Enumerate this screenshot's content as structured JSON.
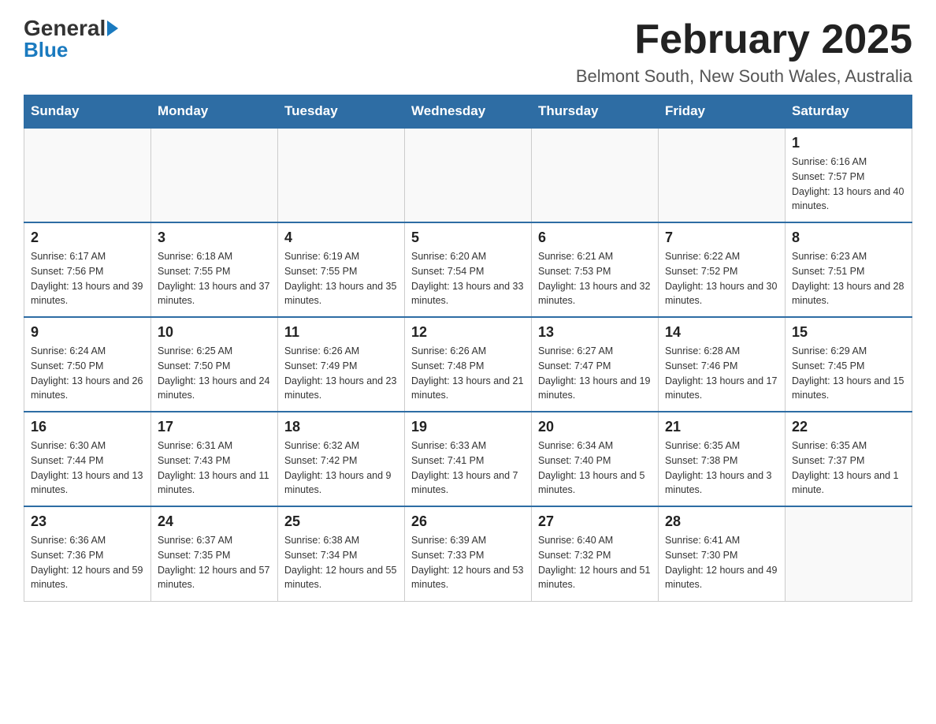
{
  "logo": {
    "general": "General",
    "blue": "Blue"
  },
  "title": "February 2025",
  "subtitle": "Belmont South, New South Wales, Australia",
  "weekdays": [
    "Sunday",
    "Monday",
    "Tuesday",
    "Wednesday",
    "Thursday",
    "Friday",
    "Saturday"
  ],
  "weeks": [
    [
      {
        "day": "",
        "sunrise": "",
        "sunset": "",
        "daylight": ""
      },
      {
        "day": "",
        "sunrise": "",
        "sunset": "",
        "daylight": ""
      },
      {
        "day": "",
        "sunrise": "",
        "sunset": "",
        "daylight": ""
      },
      {
        "day": "",
        "sunrise": "",
        "sunset": "",
        "daylight": ""
      },
      {
        "day": "",
        "sunrise": "",
        "sunset": "",
        "daylight": ""
      },
      {
        "day": "",
        "sunrise": "",
        "sunset": "",
        "daylight": ""
      },
      {
        "day": "1",
        "sunrise": "Sunrise: 6:16 AM",
        "sunset": "Sunset: 7:57 PM",
        "daylight": "Daylight: 13 hours and 40 minutes."
      }
    ],
    [
      {
        "day": "2",
        "sunrise": "Sunrise: 6:17 AM",
        "sunset": "Sunset: 7:56 PM",
        "daylight": "Daylight: 13 hours and 39 minutes."
      },
      {
        "day": "3",
        "sunrise": "Sunrise: 6:18 AM",
        "sunset": "Sunset: 7:55 PM",
        "daylight": "Daylight: 13 hours and 37 minutes."
      },
      {
        "day": "4",
        "sunrise": "Sunrise: 6:19 AM",
        "sunset": "Sunset: 7:55 PM",
        "daylight": "Daylight: 13 hours and 35 minutes."
      },
      {
        "day": "5",
        "sunrise": "Sunrise: 6:20 AM",
        "sunset": "Sunset: 7:54 PM",
        "daylight": "Daylight: 13 hours and 33 minutes."
      },
      {
        "day": "6",
        "sunrise": "Sunrise: 6:21 AM",
        "sunset": "Sunset: 7:53 PM",
        "daylight": "Daylight: 13 hours and 32 minutes."
      },
      {
        "day": "7",
        "sunrise": "Sunrise: 6:22 AM",
        "sunset": "Sunset: 7:52 PM",
        "daylight": "Daylight: 13 hours and 30 minutes."
      },
      {
        "day": "8",
        "sunrise": "Sunrise: 6:23 AM",
        "sunset": "Sunset: 7:51 PM",
        "daylight": "Daylight: 13 hours and 28 minutes."
      }
    ],
    [
      {
        "day": "9",
        "sunrise": "Sunrise: 6:24 AM",
        "sunset": "Sunset: 7:50 PM",
        "daylight": "Daylight: 13 hours and 26 minutes."
      },
      {
        "day": "10",
        "sunrise": "Sunrise: 6:25 AM",
        "sunset": "Sunset: 7:50 PM",
        "daylight": "Daylight: 13 hours and 24 minutes."
      },
      {
        "day": "11",
        "sunrise": "Sunrise: 6:26 AM",
        "sunset": "Sunset: 7:49 PM",
        "daylight": "Daylight: 13 hours and 23 minutes."
      },
      {
        "day": "12",
        "sunrise": "Sunrise: 6:26 AM",
        "sunset": "Sunset: 7:48 PM",
        "daylight": "Daylight: 13 hours and 21 minutes."
      },
      {
        "day": "13",
        "sunrise": "Sunrise: 6:27 AM",
        "sunset": "Sunset: 7:47 PM",
        "daylight": "Daylight: 13 hours and 19 minutes."
      },
      {
        "day": "14",
        "sunrise": "Sunrise: 6:28 AM",
        "sunset": "Sunset: 7:46 PM",
        "daylight": "Daylight: 13 hours and 17 minutes."
      },
      {
        "day": "15",
        "sunrise": "Sunrise: 6:29 AM",
        "sunset": "Sunset: 7:45 PM",
        "daylight": "Daylight: 13 hours and 15 minutes."
      }
    ],
    [
      {
        "day": "16",
        "sunrise": "Sunrise: 6:30 AM",
        "sunset": "Sunset: 7:44 PM",
        "daylight": "Daylight: 13 hours and 13 minutes."
      },
      {
        "day": "17",
        "sunrise": "Sunrise: 6:31 AM",
        "sunset": "Sunset: 7:43 PM",
        "daylight": "Daylight: 13 hours and 11 minutes."
      },
      {
        "day": "18",
        "sunrise": "Sunrise: 6:32 AM",
        "sunset": "Sunset: 7:42 PM",
        "daylight": "Daylight: 13 hours and 9 minutes."
      },
      {
        "day": "19",
        "sunrise": "Sunrise: 6:33 AM",
        "sunset": "Sunset: 7:41 PM",
        "daylight": "Daylight: 13 hours and 7 minutes."
      },
      {
        "day": "20",
        "sunrise": "Sunrise: 6:34 AM",
        "sunset": "Sunset: 7:40 PM",
        "daylight": "Daylight: 13 hours and 5 minutes."
      },
      {
        "day": "21",
        "sunrise": "Sunrise: 6:35 AM",
        "sunset": "Sunset: 7:38 PM",
        "daylight": "Daylight: 13 hours and 3 minutes."
      },
      {
        "day": "22",
        "sunrise": "Sunrise: 6:35 AM",
        "sunset": "Sunset: 7:37 PM",
        "daylight": "Daylight: 13 hours and 1 minute."
      }
    ],
    [
      {
        "day": "23",
        "sunrise": "Sunrise: 6:36 AM",
        "sunset": "Sunset: 7:36 PM",
        "daylight": "Daylight: 12 hours and 59 minutes."
      },
      {
        "day": "24",
        "sunrise": "Sunrise: 6:37 AM",
        "sunset": "Sunset: 7:35 PM",
        "daylight": "Daylight: 12 hours and 57 minutes."
      },
      {
        "day": "25",
        "sunrise": "Sunrise: 6:38 AM",
        "sunset": "Sunset: 7:34 PM",
        "daylight": "Daylight: 12 hours and 55 minutes."
      },
      {
        "day": "26",
        "sunrise": "Sunrise: 6:39 AM",
        "sunset": "Sunset: 7:33 PM",
        "daylight": "Daylight: 12 hours and 53 minutes."
      },
      {
        "day": "27",
        "sunrise": "Sunrise: 6:40 AM",
        "sunset": "Sunset: 7:32 PM",
        "daylight": "Daylight: 12 hours and 51 minutes."
      },
      {
        "day": "28",
        "sunrise": "Sunrise: 6:41 AM",
        "sunset": "Sunset: 7:30 PM",
        "daylight": "Daylight: 12 hours and 49 minutes."
      },
      {
        "day": "",
        "sunrise": "",
        "sunset": "",
        "daylight": ""
      }
    ]
  ]
}
